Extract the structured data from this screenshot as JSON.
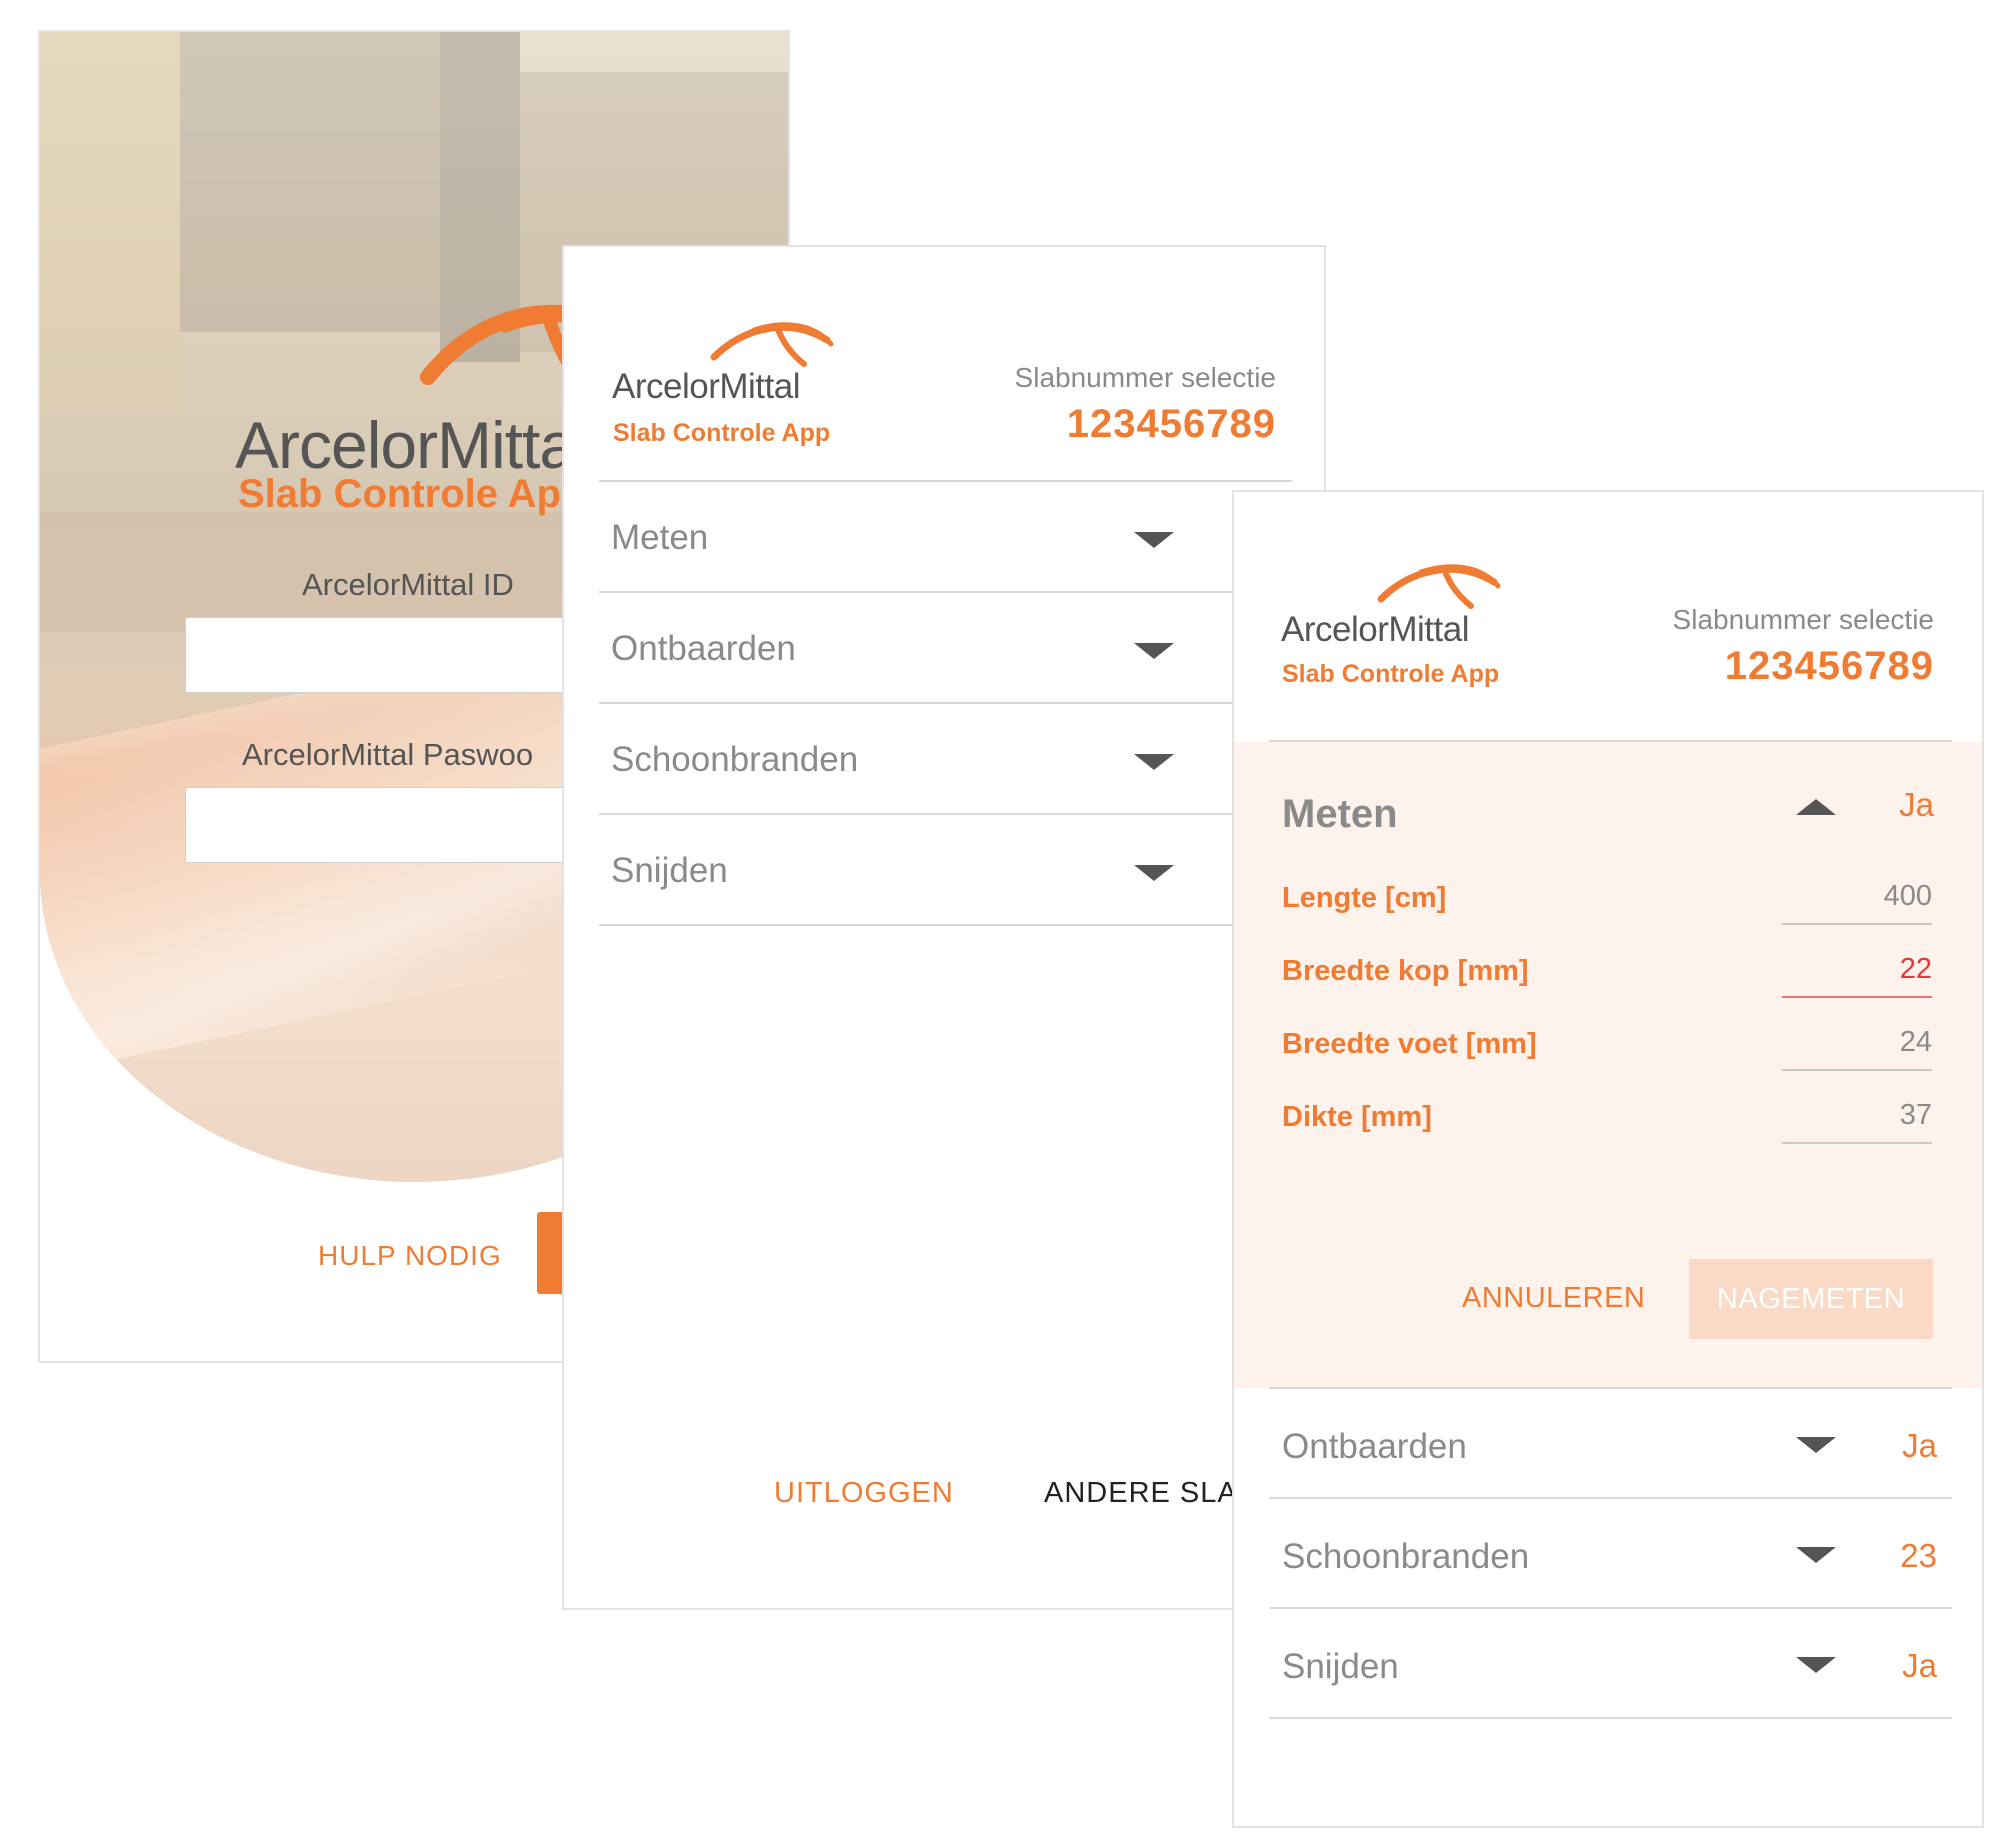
{
  "colors": {
    "accent": "#f07c33",
    "muted_text": "#8a8a8a",
    "dark_text": "#555555",
    "error": "#e53935",
    "panel_bg": "#fdf2ec"
  },
  "login": {
    "brand": "ArcelorMitta",
    "app_name": "Slab Controle App",
    "id_label": "ArcelorMittal ID",
    "password_label": "ArcelorMittal Paswoo",
    "id_value": "",
    "password_value": "",
    "help_label": "HULP NODIG"
  },
  "menu": {
    "brand": "ArcelorMittal",
    "app_name": "Slab Controle App",
    "selection_label": "Slabnummer selectie",
    "slab_number": "123456789",
    "items": [
      {
        "label": "Meten",
        "icon": "chevron-down-icon"
      },
      {
        "label": "Ontbaarden",
        "icon": "chevron-down-icon"
      },
      {
        "label": "Schoonbranden",
        "icon": "chevron-down-icon"
      },
      {
        "label": "Snijden",
        "icon": "chevron-down-icon"
      }
    ],
    "logout_label": "UITLOGGEN",
    "other_slab_label": "ANDERE SLAB"
  },
  "detail": {
    "brand": "ArcelorMittal",
    "app_name": "Slab Controle App",
    "selection_label": "Slabnummer selectie",
    "slab_number": "123456789",
    "meten": {
      "title": "Meten",
      "status": "Ja",
      "icon": "chevron-up-icon",
      "fields": [
        {
          "label": "Lengte  [cm]",
          "value": "400"
        },
        {
          "label": "Breedte kop  [mm]",
          "value": "22"
        },
        {
          "label": "Breedte voet  [mm]",
          "value": "24"
        },
        {
          "label": "Dikte  [mm]",
          "value": "37"
        }
      ],
      "cancel_label": "ANNULEREN",
      "submit_label": "NAGEMETEN"
    },
    "rows": [
      {
        "label": "Ontbaarden",
        "status": "Ja"
      },
      {
        "label": "Schoonbranden",
        "status": "23"
      },
      {
        "label": "Snijden",
        "status": "Ja"
      }
    ]
  }
}
